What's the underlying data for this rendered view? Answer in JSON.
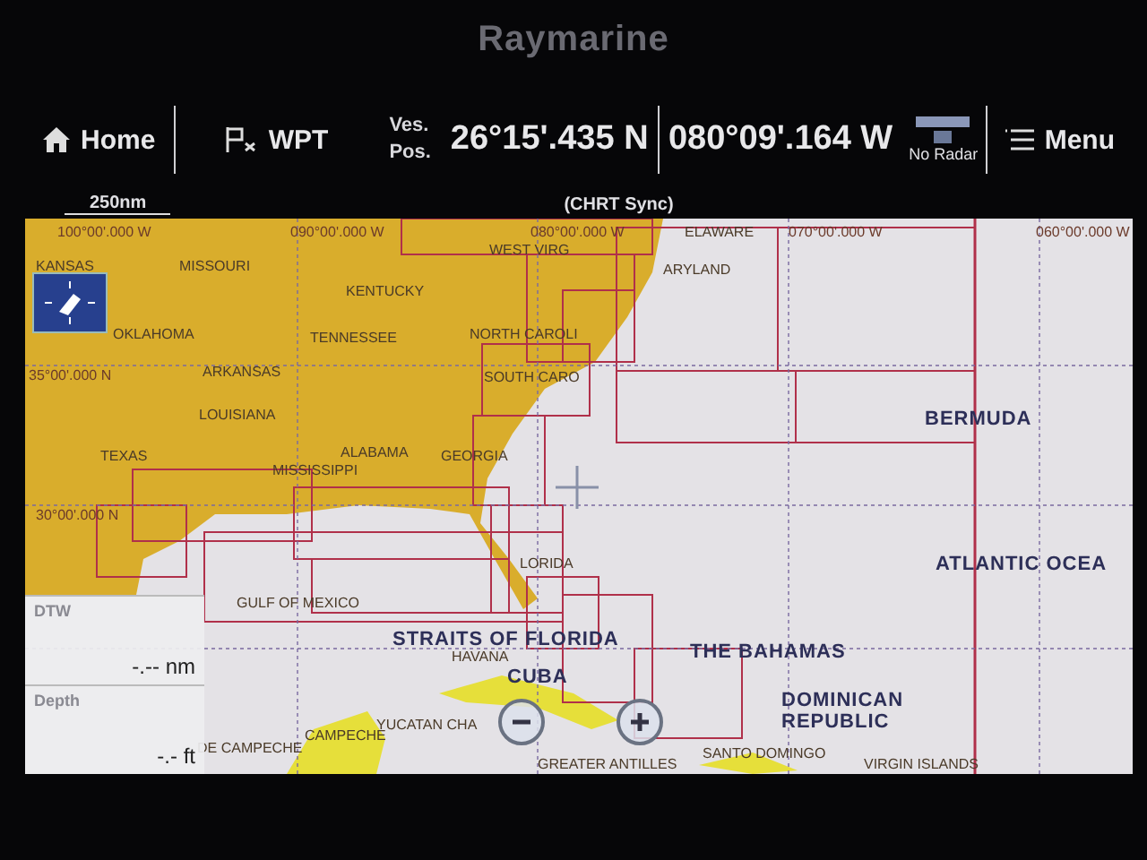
{
  "brand": "Raymarine",
  "toolbar": {
    "home": "Home",
    "waypoint": "WPT",
    "position_label": [
      "Ves.",
      "Pos."
    ],
    "latitude": "26°15'.435 N",
    "longitude": "080°09'.164 W",
    "radar_status": "No Radar",
    "menu": "Menu"
  },
  "scale": "250nm",
  "chart_mode": "(CHRT Sync)",
  "map_labels": [
    {
      "text": "100°00'.000 W",
      "kind": "grid"
    },
    {
      "text": "090°00'.000 W",
      "kind": "grid"
    },
    {
      "text": "080°00'.000 W",
      "kind": "grid"
    },
    {
      "text": "ELAWARE",
      "kind": "region"
    },
    {
      "text": "070°00'.000 W",
      "kind": "grid"
    },
    {
      "text": "060°00'.000 W",
      "kind": "grid"
    },
    {
      "text": "WEST VIRG",
      "kind": "region"
    },
    {
      "text": "KANSAS",
      "kind": "region"
    },
    {
      "text": "MISSOURI",
      "kind": "region"
    },
    {
      "text": "ARYLAND",
      "kind": "region"
    },
    {
      "text": "KENTUCKY",
      "kind": "region"
    },
    {
      "text": "OKLAHOMA",
      "kind": "region"
    },
    {
      "text": "TENNESSEE",
      "kind": "region"
    },
    {
      "text": "NORTH CAROLI",
      "kind": "region"
    },
    {
      "text": "35°00'.000 N",
      "kind": "grid"
    },
    {
      "text": "ARKANSAS",
      "kind": "region"
    },
    {
      "text": "SOUTH CARO",
      "kind": "region"
    },
    {
      "text": "LOUISIANA",
      "kind": "region"
    },
    {
      "text": "BERMUDA",
      "kind": "country"
    },
    {
      "text": "TEXAS",
      "kind": "region"
    },
    {
      "text": "ALABAMA",
      "kind": "region"
    },
    {
      "text": "GEORGIA",
      "kind": "region"
    },
    {
      "text": "MISSISSIPPI",
      "kind": "region"
    },
    {
      "text": "30°00'.000 N",
      "kind": "grid"
    },
    {
      "text": "LORIDA",
      "kind": "region"
    },
    {
      "text": "ATLANTIC OCEA",
      "kind": "country"
    },
    {
      "text": "GULF OF MEXICO",
      "kind": "region"
    },
    {
      "text": "STRAITS OF FLORIDA",
      "kind": "country"
    },
    {
      "text": "HAVANA",
      "kind": "region"
    },
    {
      "text": "THE BAHAMAS",
      "kind": "country"
    },
    {
      "text": "CUBA",
      "kind": "country"
    },
    {
      "text": "YUCATAN CHA",
      "kind": "region"
    },
    {
      "text": "CAMPECHE",
      "kind": "region"
    },
    {
      "text": "DE CAMPECHE",
      "kind": "region"
    },
    {
      "text": "DOMINICAN REPUBLIC",
      "kind": "country"
    },
    {
      "text": "SANTO DOMINGO",
      "kind": "region"
    },
    {
      "text": "GREATER ANTILLES",
      "kind": "region"
    },
    {
      "text": "VIRGIN ISLANDS",
      "kind": "region"
    }
  ],
  "data_boxes": [
    {
      "label": "DTW",
      "value": "-.-- nm"
    },
    {
      "label": "Depth",
      "value": "-.- ft"
    }
  ]
}
